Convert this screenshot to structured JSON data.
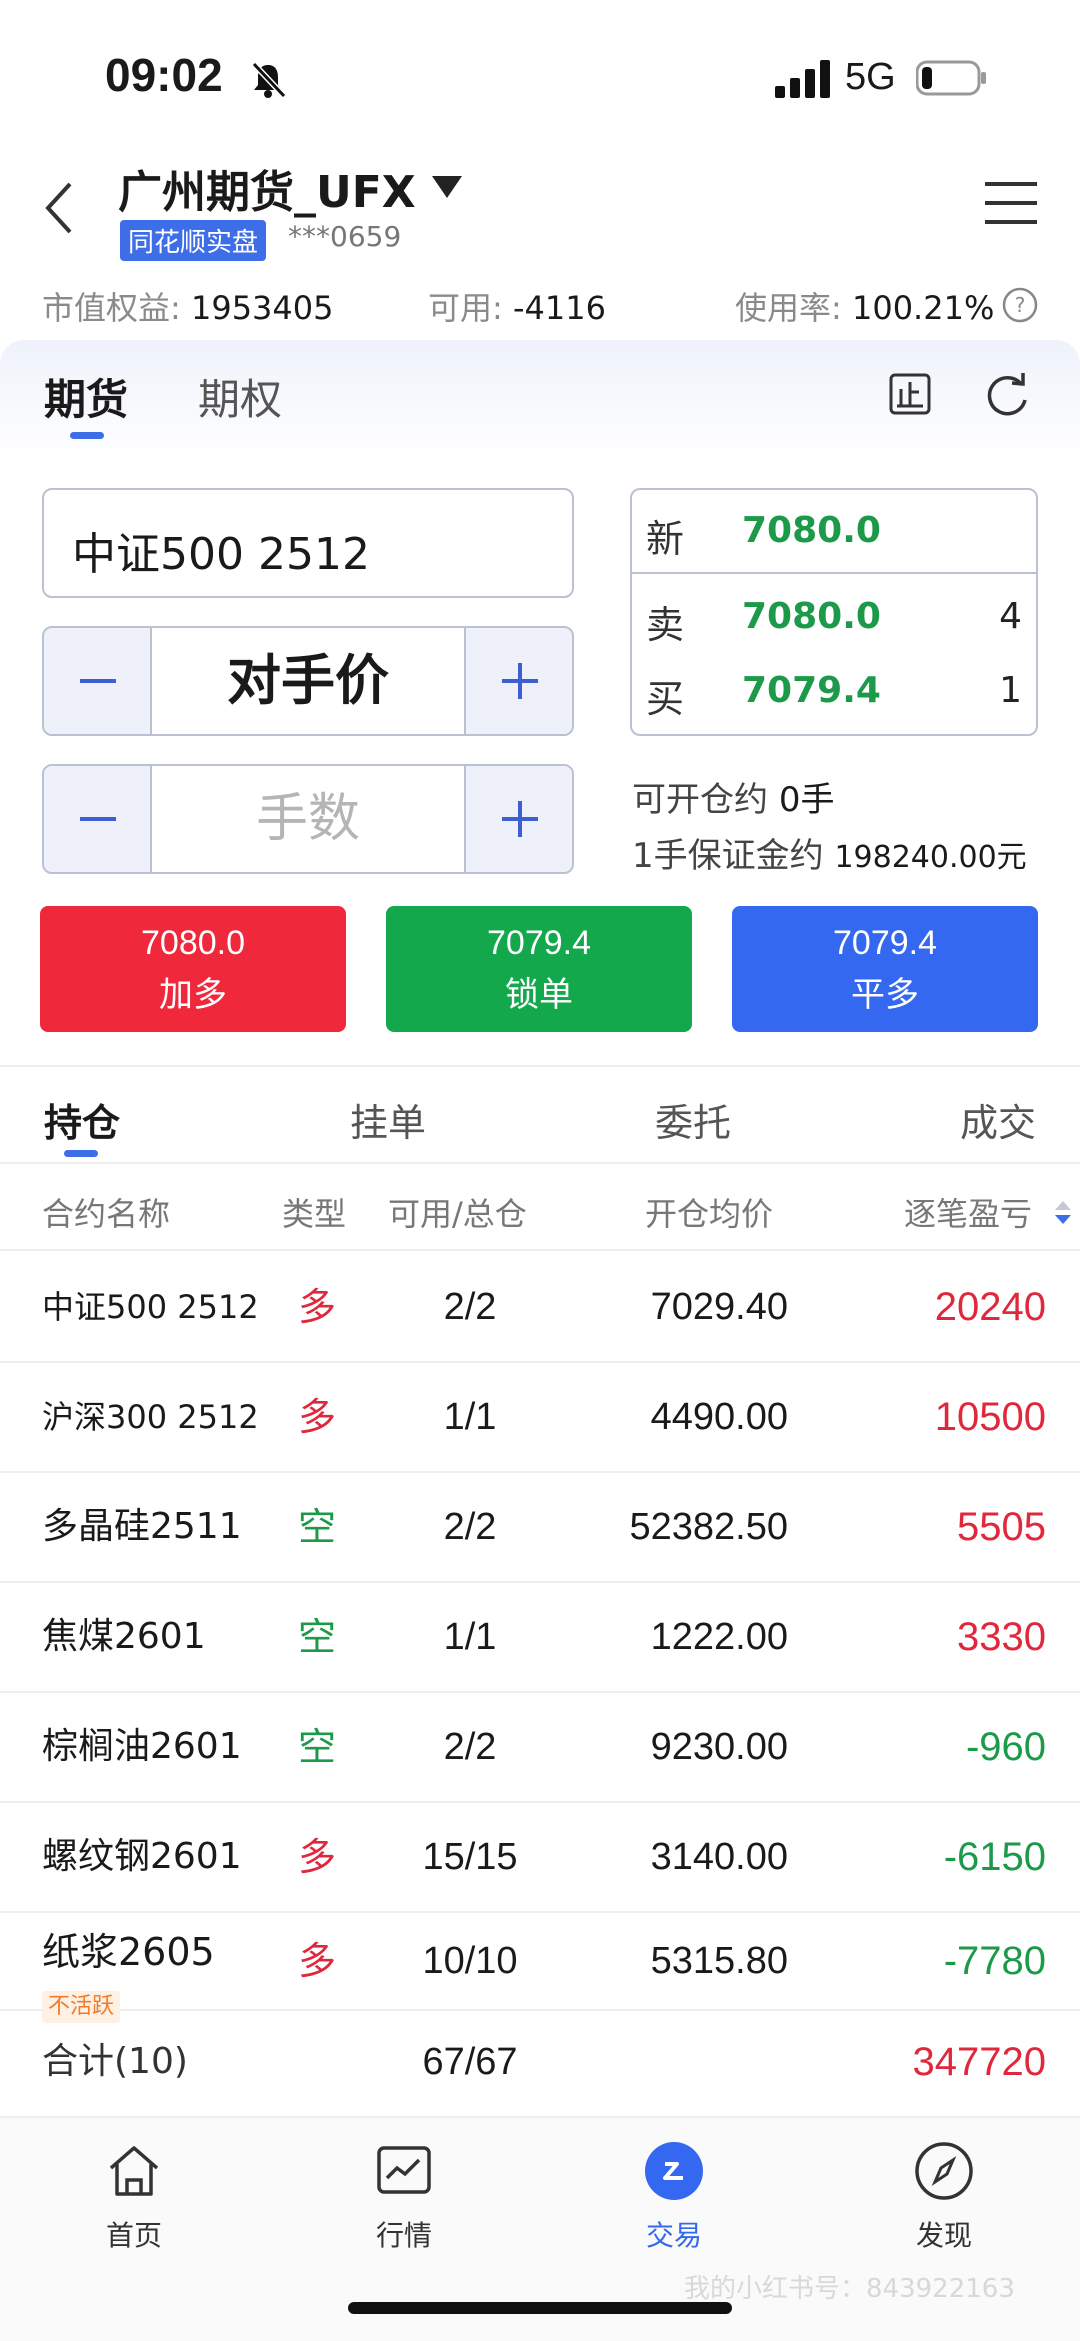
{
  "status_bar": {
    "time": "09:02",
    "network": "5G"
  },
  "header": {
    "broker": "广州期货_UFX",
    "badge": "同花顺实盘",
    "account": "***0659"
  },
  "summary": {
    "equity_label": "市值权益:",
    "equity_value": "1953405",
    "available_label": "可用:",
    "available_value": "-4116",
    "usage_label": "使用率:",
    "usage_value": "100.21%"
  },
  "trade": {
    "tabs": [
      "期货",
      "期权"
    ],
    "contract": "中证500 2512",
    "price_mode": "对手价",
    "qty_placeholder": "手数",
    "quote": {
      "last_label": "新",
      "last_value": "7080.0",
      "ask_label": "卖",
      "ask_value": "7080.0",
      "ask_vol": "4",
      "bid_label": "买",
      "bid_value": "7079.4",
      "bid_vol": "1"
    },
    "open_qty_label": "可开仓约",
    "open_qty_value": "0手",
    "margin_label": "1手保证金约",
    "margin_value": "198240.00元",
    "buttons": [
      {
        "price": "7080.0",
        "action": "加多",
        "color": "#f0283c"
      },
      {
        "price": "7079.4",
        "action": "锁单",
        "color": "#13a84c"
      },
      {
        "price": "7079.4",
        "action": "平多",
        "color": "#3468f0"
      }
    ]
  },
  "positions": {
    "tabs": [
      "持仓",
      "挂单",
      "委托",
      "成交"
    ],
    "columns": [
      "合约名称",
      "类型",
      "可用/总仓",
      "开仓均价",
      "逐笔盈亏"
    ],
    "rows": [
      {
        "name": "中证500 2512",
        "type": "多",
        "qty": "2/2",
        "price": "7029.40",
        "pnl": "20240"
      },
      {
        "name": "沪深300 2512",
        "type": "多",
        "qty": "1/1",
        "price": "4490.00",
        "pnl": "10500"
      },
      {
        "name": "多晶硅2511",
        "type": "空",
        "qty": "2/2",
        "price": "52382.50",
        "pnl": "5505"
      },
      {
        "name": "焦煤2601",
        "type": "空",
        "qty": "1/1",
        "price": "1222.00",
        "pnl": "3330"
      },
      {
        "name": "棕榈油2601",
        "type": "空",
        "qty": "2/2",
        "price": "9230.00",
        "pnl": "-960"
      },
      {
        "name": "螺纹钢2601",
        "type": "多",
        "qty": "15/15",
        "price": "3140.00",
        "pnl": "-6150"
      },
      {
        "name": "纸浆2605",
        "badge": "不活跃",
        "type": "多",
        "qty": "10/10",
        "price": "5315.80",
        "pnl": "-7780"
      }
    ],
    "total": {
      "label": "合计(10)",
      "qty": "67/67",
      "pnl": "347720"
    }
  },
  "bottom_nav": [
    {
      "label": "首页",
      "icon": "home-icon"
    },
    {
      "label": "行情",
      "icon": "chart-icon"
    },
    {
      "label": "交易",
      "icon": "trade-icon"
    },
    {
      "label": "发现",
      "icon": "compass-icon"
    }
  ],
  "watermark": "我的小红书号：843922163"
}
